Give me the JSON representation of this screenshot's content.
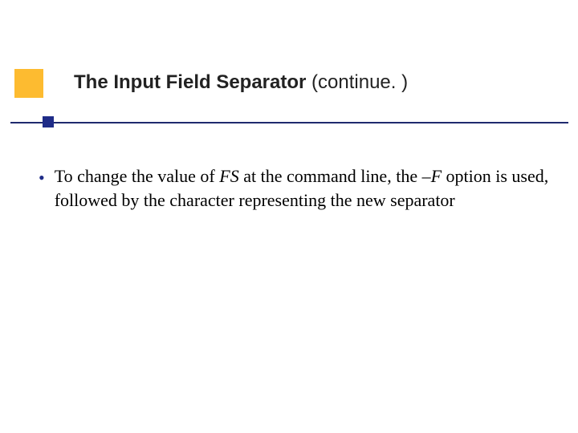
{
  "header": {
    "title_bold": "The Input Field Separator",
    "title_suffix": " (continue. )"
  },
  "content": {
    "bullets": [
      {
        "pre": "To change the value of ",
        "italic1": "FS",
        "mid": " at the command line, the ",
        "italic2": "–F",
        "post": " option is used, followed by the character representing the new separator"
      }
    ]
  }
}
